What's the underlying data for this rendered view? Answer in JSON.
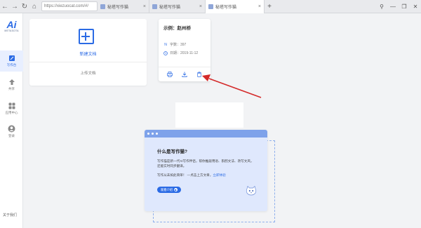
{
  "browser": {
    "url": "https://xiezuocat.com/#/",
    "tabs": [
      {
        "label": "秘塔写作猫",
        "active": false
      },
      {
        "label": "秘塔写作猫",
        "active": false
      },
      {
        "label": "秘塔写作猫",
        "active": true
      }
    ],
    "add_tab": "+"
  },
  "sidebar": {
    "logo_text": "METASOTA",
    "items": [
      {
        "label": "写作台",
        "icon": "edit-icon",
        "active": true
      },
      {
        "label": "共享",
        "icon": "share-icon",
        "active": false
      },
      {
        "label": "应用中心",
        "icon": "apps-icon",
        "active": false
      },
      {
        "label": "登录",
        "icon": "user-icon",
        "active": false
      }
    ],
    "about": "关于我们"
  },
  "new_doc": {
    "label": "新建文档",
    "upload": "上传文档"
  },
  "sample_doc": {
    "title": "示例：赵州桥",
    "word_count": "字数：397",
    "date": "日期：2019-11-12",
    "actions": [
      "print-icon",
      "download-icon",
      "delete-icon"
    ]
  },
  "intro": {
    "title": "什么是写作猫?",
    "desc": "写作猫是新一代AI写作伴侣，帮你推敲用语、斟酌文法、改写文风，还能实时同步翻译。",
    "question": "写作从未如此简单！ —点击上方文章，",
    "link": "立即体验",
    "button": "观看介绍"
  },
  "colors": {
    "accent": "#2b6be5",
    "intro_bg": "#dfe8fd",
    "annotation": "#d42a2a"
  }
}
